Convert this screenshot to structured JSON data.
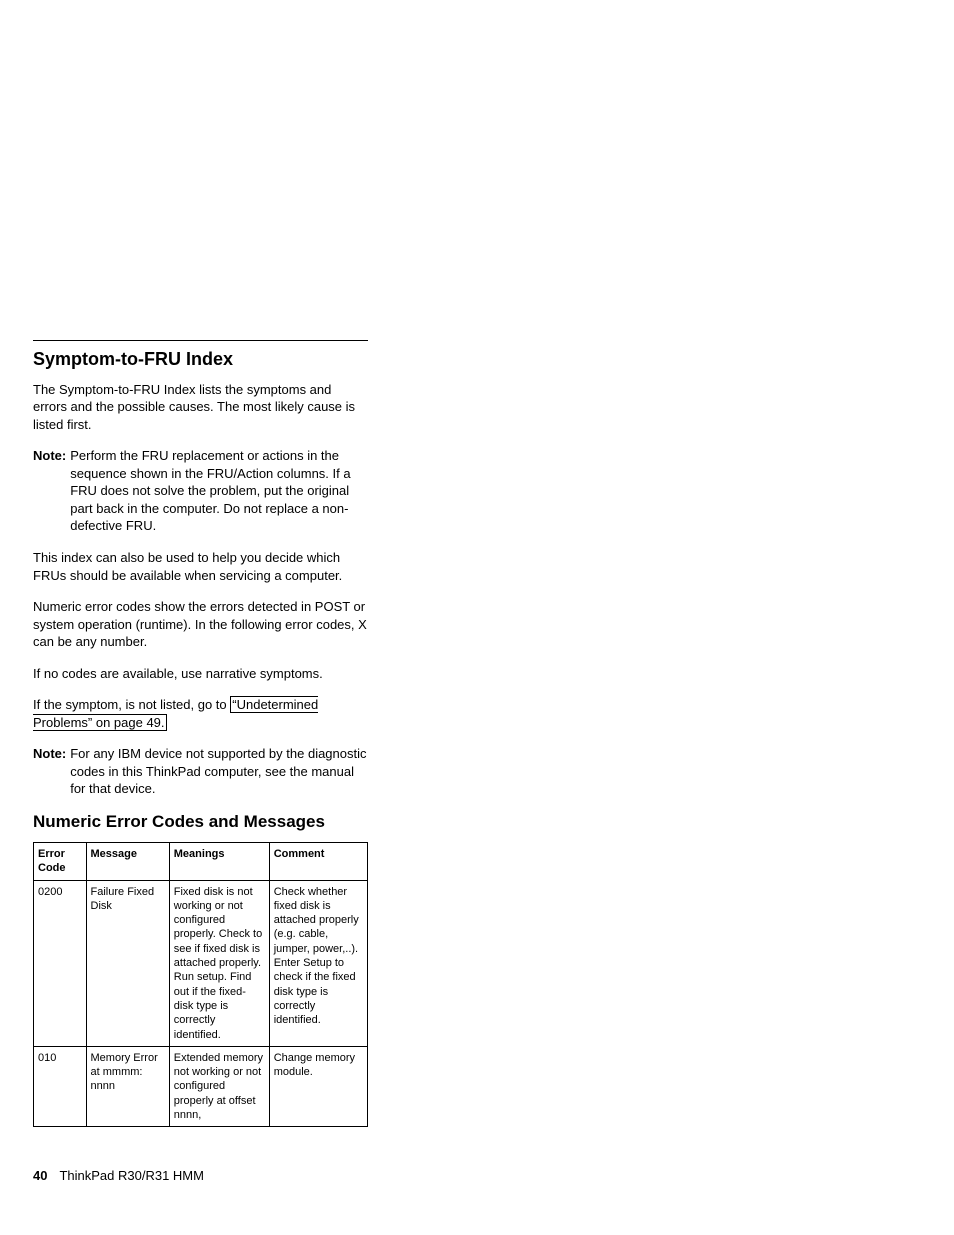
{
  "heading1": "Symptom-to-FRU Index",
  "para1": "The Symptom-to-FRU Index lists the symptoms and errors and the possible causes. The most likely cause is listed first.",
  "note1_label": "Note:",
  "note1_body": "Perform the FRU replacement or actions in the sequence shown in the FRU/Action columns. If a FRU does not solve the problem, put the original part back in the computer. Do not replace a non-defective FRU.",
  "para2": "This index can also be used to help you decide which FRUs should be available when servicing a computer.",
  "para3": "Numeric error codes show the errors detected in POST or system operation (runtime). In the following error codes, X can be any number.",
  "para4": "If no codes are available, use narrative symptoms.",
  "para5_pre": "If the symptom, is not listed, go to ",
  "para5_link": "“Undetermined Problems” on page 49.",
  "note2_label": "Note:",
  "note2_body": "For any IBM device not supported by the diagnostic codes in this ThinkPad computer, see the manual for that device.",
  "heading2": "Numeric Error Codes and Messages",
  "table": {
    "headers": {
      "code": "Error Code",
      "message": "Message",
      "meanings": "Meanings",
      "comment": "Comment"
    },
    "rows": [
      {
        "code": "0200",
        "message": "Failure Fixed Disk",
        "meanings": "Fixed disk is not working or not configured properly. Check to see if fixed disk is attached properly. Run setup. Find out if the fixed-disk type is correctly identified.",
        "comment": "Check whether fixed disk is attached properly (e.g. cable, jumper, power,..). Enter Setup to check if the fixed disk type is correctly identified."
      },
      {
        "code": "010",
        "message": "Memory Error at mmmm: nnnn",
        "meanings": "Extended memory not working or not configured properly at offset nnnn,",
        "comment": "Change memory module."
      }
    ]
  },
  "footer": {
    "page_number": "40",
    "title": "ThinkPad R30/R31 HMM"
  }
}
